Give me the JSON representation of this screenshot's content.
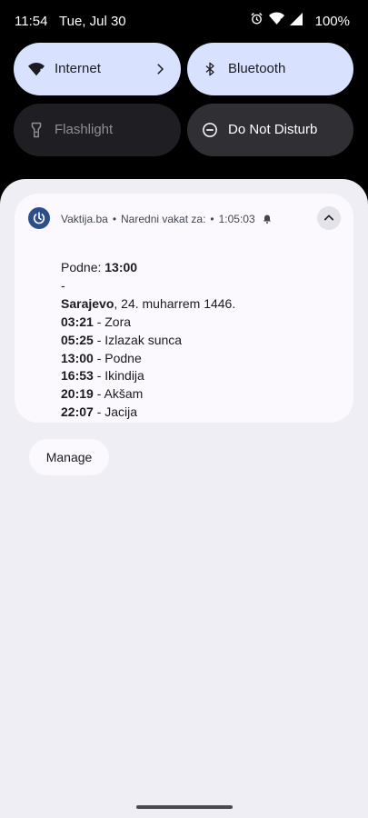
{
  "statusbar": {
    "time": "11:54",
    "date": "Tue, Jul 30",
    "battery": "100%",
    "icons": [
      "alarm-icon",
      "wifi-icon",
      "cell-signal-icon"
    ]
  },
  "quick_tiles": {
    "internet": {
      "label": "Internet",
      "icon": "wifi-icon",
      "state": "on"
    },
    "bluetooth": {
      "label": "Bluetooth",
      "icon": "bluetooth-icon",
      "state": "on"
    },
    "flashlight": {
      "label": "Flashlight",
      "icon": "flashlight-icon",
      "state": "off"
    },
    "dnd": {
      "label": "Do Not Disturb",
      "icon": "dnd-icon",
      "state": "off"
    }
  },
  "notification": {
    "app_name": "Vaktija.ba",
    "title": "Naredni vakat za:",
    "countdown": "1:05:03",
    "line1": {
      "label": "Podne: ",
      "value": "13:00"
    },
    "dash": "-",
    "city": {
      "name": "Sarajevo",
      "rest": ", 24. muharrem 1446."
    },
    "prayers": [
      {
        "time": "03:21",
        "name": " - Zora"
      },
      {
        "time": "05:25",
        "name": " - Izlazak sunca"
      },
      {
        "time": "13:00",
        "name": " - Podne"
      },
      {
        "time": "16:53",
        "name": " - Ikindija"
      },
      {
        "time": "20:19",
        "name": " - Akšam"
      },
      {
        "time": "22:07",
        "name": " - Jacija"
      }
    ]
  },
  "manage_label": "Manage",
  "colors": {
    "tile_on": "#d8e2ff",
    "app_icon": "#2c4f8c",
    "shade": "#efeef5"
  }
}
